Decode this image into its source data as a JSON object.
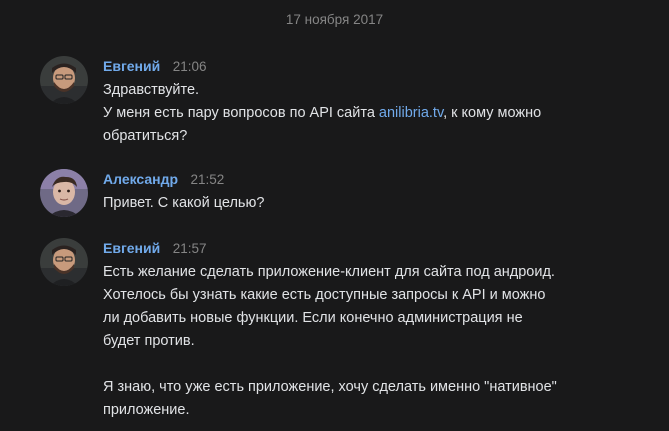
{
  "date_separator": "17 ноября 2017",
  "messages": [
    {
      "author": "Евгений",
      "time": "21:06",
      "line1": "Здравствуйте.",
      "line2_before": "У меня есть пару вопросов по API сайта ",
      "link": "anilibria.tv",
      "line2_after": ", к кому можно",
      "line3": "обратиться?"
    },
    {
      "author": "Александр",
      "time": "21:52",
      "line1": "Привет. С какой целью?"
    },
    {
      "author": "Евгений",
      "time": "21:57",
      "lines": [
        "Есть желание сделать приложение-клиент для сайта под андроид.",
        "Хотелось бы узнать какие есть доступные запросы к API и можно",
        "ли добавить новые функции. Если конечно администрация не",
        "будет против.",
        "Я знаю, что уже есть приложение, хочу сделать именно \"нативное\"",
        "приложение."
      ]
    }
  ]
}
